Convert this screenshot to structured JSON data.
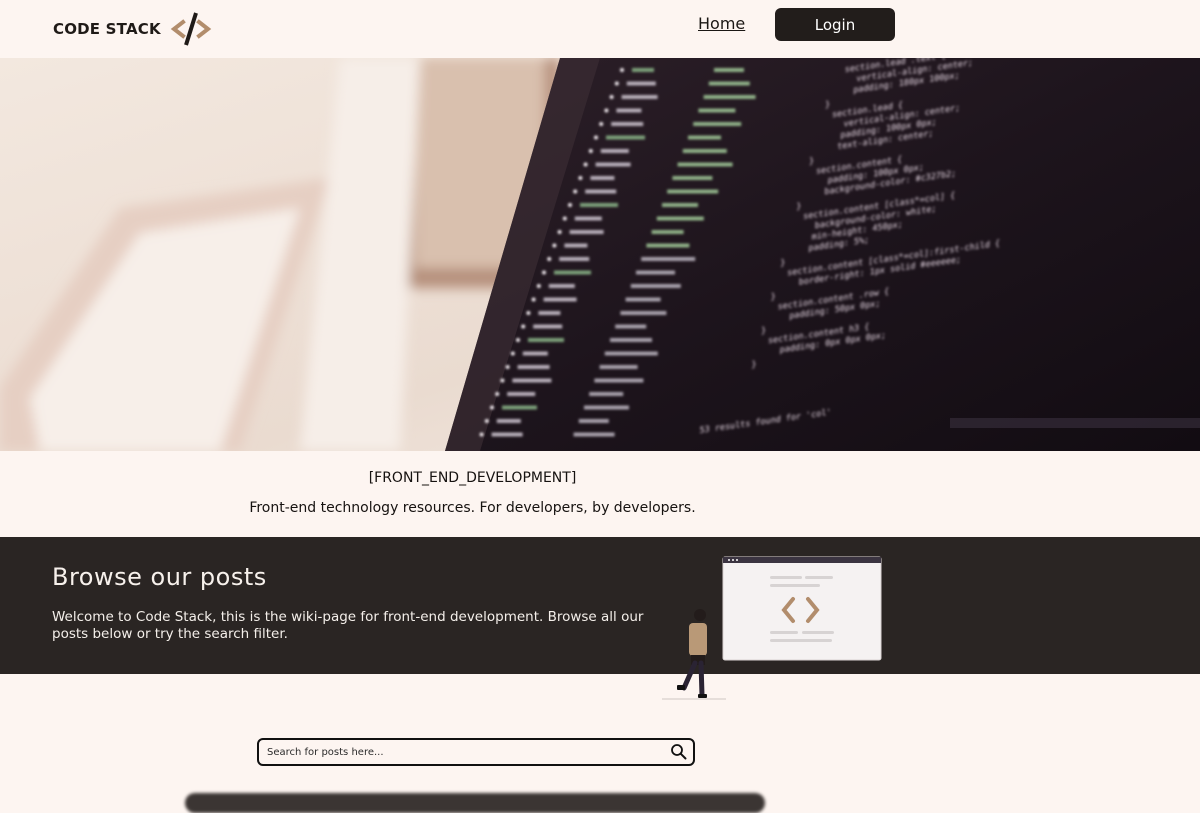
{
  "header": {
    "logo_text": "CODE STACK",
    "nav_home": "Home",
    "nav_login": "Login"
  },
  "hero": {
    "code_lines": [
      "section.lead .text {",
      "vertical-align: center;",
      "padding: 180px 100px;",
      "}",
      "section.lead {",
      "vertical-align: center;",
      "padding: 100px 0px;",
      "text-align: center;",
      "}",
      "section.content {",
      "padding: 100px 0px;",
      "background-color: #c327b2;",
      "}",
      "section.content [class*=col] {",
      "background-color: white;",
      "min-height: 450px;",
      "padding: 5%;",
      "}",
      "section.content [class*=col]:first-child {",
      "border-right: 1px solid #eeeeee;",
      "}",
      "section.content .row {",
      "padding: 50px 0px;",
      "}",
      "section.content h3 {",
      "padding: 0px 0px 0px;",
      "}",
      "53 results found for 'col'"
    ]
  },
  "tagline": {
    "title": "[FRONT_END_DEVELOPMENT]",
    "subtitle": "Front-end technology resources. For developers, by developers."
  },
  "browse": {
    "title": "Browse our posts",
    "text": "Welcome to Code Stack, this is the wiki-page for front-end development. Browse all our posts below or try the search filter."
  },
  "search": {
    "placeholder": "Search for posts here...",
    "value": ""
  },
  "icons": {
    "logo": "code-slash-icon",
    "search": "magnifier-icon",
    "illustration": "developer-with-code-window-illustration"
  },
  "colors": {
    "page_bg": "#fdf5f1",
    "dark_band": "#2a2523",
    "login_button": "#221d1b",
    "accent": "#b28d6c"
  }
}
